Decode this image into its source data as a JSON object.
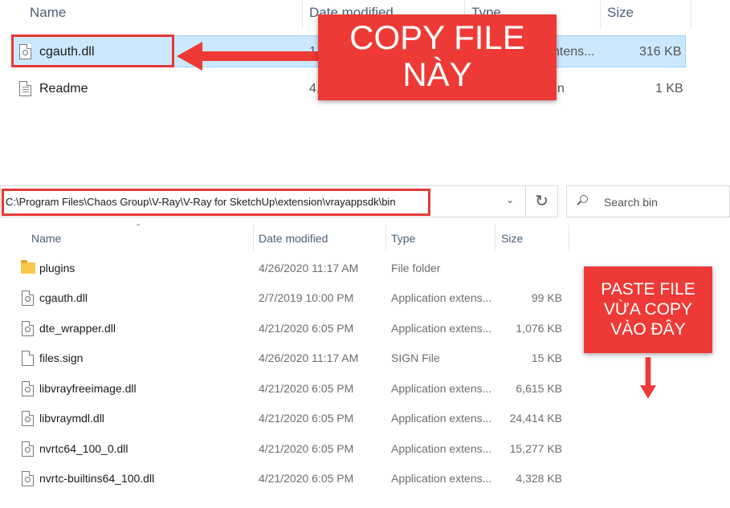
{
  "top": {
    "columns": [
      "Name",
      "Date modified",
      "Type",
      "Size"
    ],
    "files": [
      {
        "name": "cgauth.dll",
        "date": "1",
        "type": "ntens...",
        "size": "316 KB",
        "icon": "dll-file-icon",
        "selected": true
      },
      {
        "name": "Readme",
        "date": "4,",
        "type": "n",
        "size": "1 KB",
        "icon": "text-file-icon",
        "selected": false
      }
    ]
  },
  "callouts": {
    "copy_line1": "COPY FILE",
    "copy_line2": "NÀY",
    "paste_line1": "PASTE FILE",
    "paste_line2": "VỪA COPY",
    "paste_line3": "VÀO ĐÂY"
  },
  "bottom": {
    "address": "C:\\Program Files\\Chaos Group\\V-Ray\\V-Ray for SketchUp\\extension\\vrayappsdk\\bin",
    "search_placeholder": "Search bin",
    "columns": [
      "Name",
      "Date modified",
      "Type",
      "Size"
    ],
    "files": [
      {
        "name": "plugins",
        "date": "4/26/2020 11:17 AM",
        "type": "File folder",
        "size": "",
        "icon": "folder-icon"
      },
      {
        "name": "cgauth.dll",
        "date": "2/7/2019 10:00 PM",
        "type": "Application extens...",
        "size": "99 KB",
        "icon": "dll-file-icon"
      },
      {
        "name": "dte_wrapper.dll",
        "date": "4/21/2020 6:05 PM",
        "type": "Application extens...",
        "size": "1,076 KB",
        "icon": "dll-file-icon"
      },
      {
        "name": "files.sign",
        "date": "4/26/2020 11:17 AM",
        "type": "SIGN File",
        "size": "15 KB",
        "icon": "generic-file-icon"
      },
      {
        "name": "libvrayfreeimage.dll",
        "date": "4/21/2020 6:05 PM",
        "type": "Application extens...",
        "size": "6,615 KB",
        "icon": "dll-file-icon"
      },
      {
        "name": "libvraymdl.dll",
        "date": "4/21/2020 6:05 PM",
        "type": "Application extens...",
        "size": "24,414 KB",
        "icon": "dll-file-icon"
      },
      {
        "name": "nvrtc64_100_0.dll",
        "date": "4/21/2020 6:05 PM",
        "type": "Application extens...",
        "size": "15,277 KB",
        "icon": "dll-file-icon"
      },
      {
        "name": "nvrtc-builtins64_100.dll",
        "date": "4/21/2020 6:05 PM",
        "type": "Application extens...",
        "size": "4,328 KB",
        "icon": "dll-file-icon"
      }
    ]
  },
  "colors": {
    "callout": "#ee3a36",
    "highlight_border": "#e53935",
    "selection": "#cce8ff"
  }
}
